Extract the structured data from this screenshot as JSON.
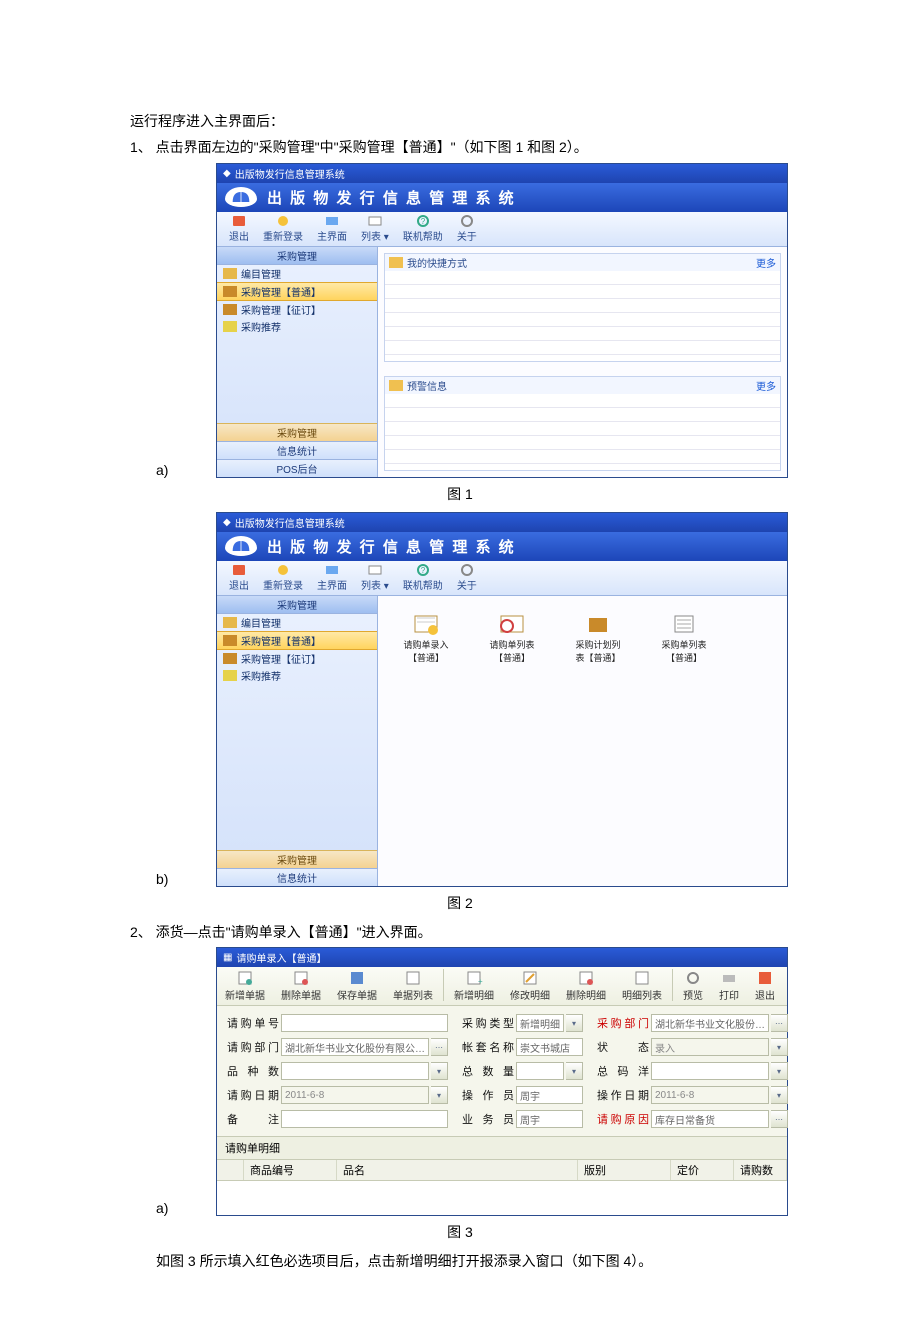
{
  "text": {
    "intro": "运行程序进入主界面后：",
    "step1": "1、 点击界面左边的\"采购管理\"中\"采购管理【普通】\"（如下图 1 和图 2）。",
    "a_marker": "a)",
    "b_marker": "b)",
    "fig1": "图 1",
    "fig2": "图 2",
    "step2": "2、 添货—点击\"请购单录入【普通】\"进入界面。",
    "fig3": "图 3",
    "closing": "如图 3 所示填入红色必选项目后，点击新增明细打开报添录入窗口（如下图 4）。"
  },
  "app": {
    "win_title": "出版物发行信息管理系统",
    "banner": "出 版 物 发 行 信 息 管 理 系 统",
    "toolbar": {
      "exit": "退出",
      "relogin": "重新登录",
      "main": "主界面",
      "list": "列表",
      "help": "联机帮助",
      "about": "关于"
    },
    "side_head": "采购管理",
    "side_items": {
      "catalog": "编目管理",
      "pm_normal": "采购管理【普通】",
      "pm_zd": "采购管理【征订】",
      "pm_rec": "采购推荐"
    },
    "side_bottom": {
      "a": "采购管理",
      "b": "信息统计",
      "c": "POS后台"
    },
    "panel1": {
      "title": "我的快捷方式",
      "more": "更多"
    },
    "panel2": {
      "title": "预警信息",
      "more": "更多"
    },
    "apps": {
      "a": "请购单录入\n【普通】",
      "b": "请购单列表\n【普通】",
      "c": "采购计划列\n表【普通】",
      "d": "采购单列表\n【普通】"
    }
  },
  "form": {
    "title": "请购单录入【普通】",
    "tb": {
      "new": "新增单据",
      "del": "删除单据",
      "save": "保存单据",
      "list": "单据列表",
      "newd": "新增明细",
      "editd": "修改明细",
      "deld": "删除明细",
      "dlist": "明细列表",
      "preview": "预览",
      "print": "打印",
      "exit": "退出"
    },
    "labels": {
      "no": "请购单号",
      "ctype": "采购类型",
      "cdept": "采购部门",
      "rdept": "请购部门",
      "acct": "帐套名称",
      "status": "状 态",
      "kinds": "品 种 数",
      "qty": "总 数 量",
      "amount": "总 码 洋",
      "rdate": "请购日期",
      "operator": "操 作 员",
      "odate": "操作日期",
      "remark": "备 注",
      "clerk": "业 务 员",
      "reason": "请购原因"
    },
    "values": {
      "ctype": "新增明细",
      "cdept": "湖北新华书业文化股份…",
      "rdept": "湖北新华书业文化股份有限公…",
      "acct": "崇文书城店",
      "status": "录入",
      "rdate": "2011-6-8",
      "operator": "周宇",
      "odate": "2011-6-8",
      "clerk": "周宇",
      "reason": "库存日常备货"
    },
    "detail_title": "请购单明细",
    "cols": {
      "code": "商品编号",
      "name": "品名",
      "edition": "版别",
      "price": "定价",
      "qty": "请购数"
    }
  }
}
